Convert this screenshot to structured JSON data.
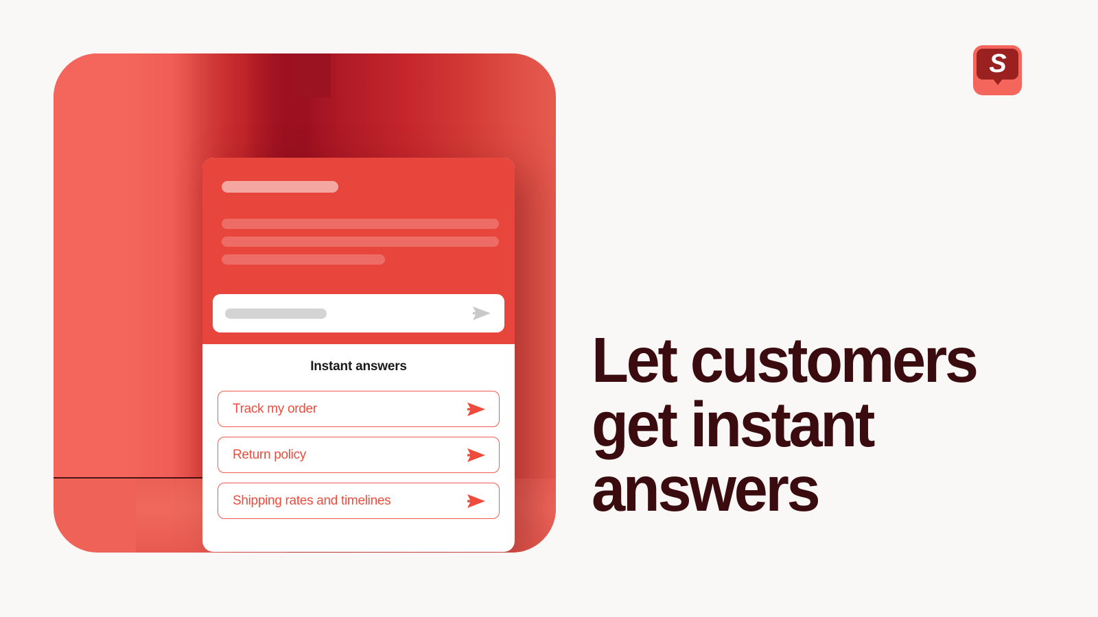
{
  "page": {
    "background_color": "#FAF8F6"
  },
  "brand": {
    "logo_name": "speech-bubble-s-logo",
    "logo_letter": "S",
    "tile_color": "#F4665C",
    "bubble_color": "#9B2020",
    "letter_color": "#FFFFFF"
  },
  "headline": {
    "line1": "Let customers",
    "line2": "get instant",
    "line3": "answers",
    "color": "#3A0C10"
  },
  "illustration": {
    "backdrop_color": "#F4665C",
    "shadow_color": "#9B1220",
    "floor_color": "#EE6257",
    "notch_color": "#9B1220"
  },
  "widget": {
    "header": {
      "background_color": "#E8453C",
      "skeleton_title": "",
      "skeleton_lines": [
        "",
        "",
        ""
      ]
    },
    "composer": {
      "name": "message-input",
      "value": "",
      "placeholder": "",
      "send_icon": "send-arrow-icon",
      "send_icon_color": "#C9C9C9",
      "background_color": "#FFFFFF"
    },
    "panel": {
      "title": "Instant answers",
      "title_color": "#1A1A1A",
      "accent_color": "#EE4B3C",
      "answers": [
        {
          "label": "Track my order",
          "icon": "send-arrow-icon"
        },
        {
          "label": "Return policy",
          "icon": "send-arrow-icon"
        },
        {
          "label": "Shipping rates and timelines",
          "icon": "send-arrow-icon"
        }
      ]
    }
  }
}
